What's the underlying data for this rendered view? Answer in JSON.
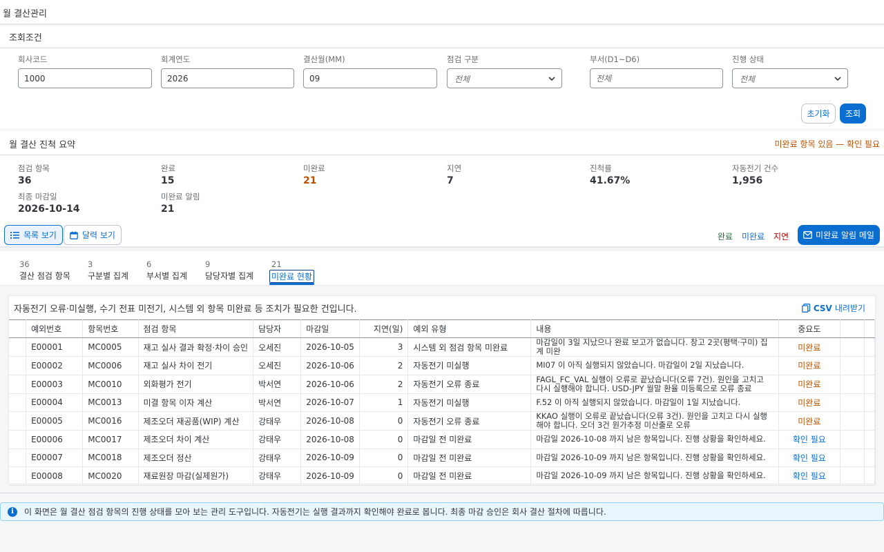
{
  "page": {
    "title": "월 결산관리"
  },
  "filters": {
    "section_title": "조회조건",
    "company_code": {
      "label": "회사코드",
      "value": "1000"
    },
    "fiscal_year": {
      "label": "회계연도",
      "value": "2026"
    },
    "period": {
      "label": "결산월(MM)",
      "value": "09"
    },
    "check_type": {
      "label": "점검 구분",
      "value": "전체"
    },
    "department": {
      "label": "부서(D1~D6)",
      "placeholder": "전체"
    },
    "status": {
      "label": "진행 상태",
      "value": "전체"
    },
    "reset_label": "초기화",
    "search_label": "조회"
  },
  "summary": {
    "title": "월 결산 진척 요약",
    "alert": "미완료 항목 있음 — 확인 필요",
    "kpis": {
      "check_items": {
        "label": "점검 항목",
        "value": "36"
      },
      "completed": {
        "label": "완료",
        "value": "15"
      },
      "incomplete": {
        "label": "미완료",
        "value": "21"
      },
      "delayed": {
        "label": "지연",
        "value": "7"
      },
      "progress": {
        "label": "진척률",
        "value": "41.67%"
      },
      "auto_posting": {
        "label": "자동전기 건수",
        "value": "1,956"
      },
      "final_deadline": {
        "label": "최종 마감일",
        "value": "2026-10-14"
      },
      "incomplete_alerts": {
        "label": "미완료 알림",
        "value": "21"
      }
    }
  },
  "view_bar": {
    "list_view": "목록 보기",
    "calendar_view": "달력 보기",
    "legend": {
      "done": "완료",
      "incomplete": "미완료",
      "delayed": "지연"
    },
    "mail_button": "미완료 알림 메일"
  },
  "tabs": [
    {
      "count": "36",
      "label": "결산 점검 항목"
    },
    {
      "count": "3",
      "label": "구분별 집계"
    },
    {
      "count": "6",
      "label": "부서별 집계"
    },
    {
      "count": "9",
      "label": "담당자별 집계"
    },
    {
      "count": "21",
      "label": "미완료 현황"
    }
  ],
  "exceptions": {
    "description": "자동전기 오류·미실행, 수기 전표 미전기, 시스템 외 항목 미완료 등 조치가 필요한 건입니다.",
    "csv_label": "CSV",
    "csv_suffix": "내려받기",
    "columns": [
      "예외번호",
      "항목번호",
      "점검 항목",
      "담당자",
      "마감일",
      "지연(일)",
      "예외 유형",
      "내용",
      "중요도"
    ],
    "rows": [
      {
        "id": "E00001",
        "item": "MC0005",
        "name": "재고 실사 결과 확정·차이 승인",
        "owner": "오세진",
        "due": "2026-10-05",
        "delay": "3",
        "type": "시스템 외 점검 항목 미완료",
        "content": "마감일이 3일 지났으나 완료 보고가 없습니다. 창고 2곳(평택·구미) 집계 미완",
        "status": "미완료",
        "status_kind": "incomplete"
      },
      {
        "id": "E00002",
        "item": "MC0006",
        "name": "재고 실사 차이 전기",
        "owner": "오세진",
        "due": "2026-10-06",
        "delay": "2",
        "type": "자동전기 미실행",
        "content": "MI07 이 아직 실행되지 않았습니다. 마감일이 2일 지났습니다.",
        "status": "미완료",
        "status_kind": "incomplete"
      },
      {
        "id": "E00003",
        "item": "MC0010",
        "name": "외화평가 전기",
        "owner": "박서연",
        "due": "2026-10-06",
        "delay": "2",
        "type": "자동전기 오류 종료",
        "content": "FAGL_FC_VAL 실행이 오류로 끝났습니다(오류 7건). 원인을 고치고 다시 실행해야 합니다. USD-JPY 월말 환율 미등록으로 오류 종료",
        "status": "미완료",
        "status_kind": "incomplete"
      },
      {
        "id": "E00004",
        "item": "MC0013",
        "name": "미결 항목 이자 계산",
        "owner": "박서연",
        "due": "2026-10-07",
        "delay": "1",
        "type": "자동전기 미실행",
        "content": "F.52 이 아직 실행되지 않았습니다. 마감일이 1일 지났습니다.",
        "status": "미완료",
        "status_kind": "incomplete"
      },
      {
        "id": "E00005",
        "item": "MC0016",
        "name": "제조오더 재공품(WIP) 계산",
        "owner": "강태우",
        "due": "2026-10-08",
        "delay": "0",
        "type": "자동전기 오류 종료",
        "content": "KKAO 실행이 오류로 끝났습니다(오류 3건). 원인을 고치고 다시 실행해야 합니다. 오더 3건 원가추정 미산출로 오류",
        "status": "미완료",
        "status_kind": "incomplete"
      },
      {
        "id": "E00006",
        "item": "MC0017",
        "name": "제조오더 차이 계산",
        "owner": "강태우",
        "due": "2026-10-08",
        "delay": "0",
        "type": "마감일 전 미완료",
        "content": "마감일 2026-10-08 까지 남은 항목입니다. 진행 상황을 확인하세요.",
        "status": "확인 필요",
        "status_kind": "check"
      },
      {
        "id": "E00007",
        "item": "MC0018",
        "name": "제조오더 정산",
        "owner": "강태우",
        "due": "2026-10-09",
        "delay": "0",
        "type": "마감일 전 미완료",
        "content": "마감일 2026-10-09 까지 남은 항목입니다. 진행 상황을 확인하세요.",
        "status": "확인 필요",
        "status_kind": "check"
      },
      {
        "id": "E00008",
        "item": "MC0020",
        "name": "재료원장 마감(실제원가)",
        "owner": "강태우",
        "due": "2026-10-09",
        "delay": "0",
        "type": "마감일 전 미완료",
        "content": "마감일 2026-10-09 까지 남은 항목입니다. 진행 상황을 확인하세요.",
        "status": "확인 필요",
        "status_kind": "check"
      }
    ]
  },
  "info": {
    "text": "이 화면은 월 결산 점검 항목의 진행 상태를 모아 보는 관리 도구입니다. 자동전기는 실행 결과까지 확인해야 완료로 봅니다. 최종 마감 승인은 회사 결산 절차에 따릅니다."
  },
  "colors": {
    "accent": "#0a6ed1",
    "warning": "#b95000",
    "danger": "#bb0000",
    "success": "#256f3a"
  },
  "icons": {
    "list": "list-icon",
    "calendar": "calendar-icon",
    "mail": "mail-icon",
    "csv": "csv-file-icon",
    "info": "info-icon",
    "chevron": "chevron-down-icon"
  }
}
